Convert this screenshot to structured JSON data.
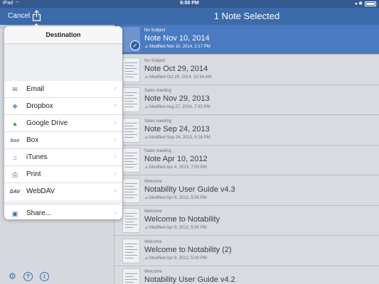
{
  "status_bar": {
    "device": "iPad",
    "wifi": "⌔",
    "time": "6:58 PM",
    "icons": "◂ ✱"
  },
  "nav": {
    "cancel_label": "Cancel",
    "title": "1 Note Selected"
  },
  "popover": {
    "title": "Destination",
    "items": [
      {
        "label": "Email",
        "icon": "email-icon",
        "glyph": "✉"
      },
      {
        "label": "Dropbox",
        "icon": "dropbox-icon",
        "glyph": "❖"
      },
      {
        "label": "Google Drive",
        "icon": "google-drive-icon",
        "glyph": "▲"
      },
      {
        "label": "Box",
        "icon": "box-icon",
        "glyph": "box"
      },
      {
        "label": "iTunes",
        "icon": "itunes-icon",
        "glyph": "♫"
      },
      {
        "label": "Print",
        "icon": "printer-icon",
        "glyph": "⎙"
      },
      {
        "label": "WebDAV",
        "icon": "webdav-icon",
        "glyph": "DAV"
      }
    ],
    "share": {
      "label": "Share...",
      "icon": "share-icon",
      "glyph": "▣"
    },
    "chevron": "›"
  },
  "sidebar_footer": {
    "settings_glyph": "⚙",
    "help_glyph": "?",
    "info_glyph": "i"
  },
  "notes": [
    {
      "subject": "No Subject",
      "title": "Note Nov 10, 2014",
      "modified": "Modified Nov 10, 2014, 2:17 PM",
      "selected": true
    },
    {
      "subject": "No Subject",
      "title": "Note Oct 29, 2014",
      "modified": "Modified Oct 29, 2014, 10:34 AM",
      "selected": false
    },
    {
      "subject": "Sales meeting",
      "title": "Note Nov 29, 2013",
      "modified": "Modified Aug 27, 2014, 7:33 PM",
      "selected": false
    },
    {
      "subject": "Sales meeting",
      "title": "Note Sep 24, 2013",
      "modified": "Modified Sep 24, 2013, 6:16 PM",
      "selected": false
    },
    {
      "subject": "Sales meeting",
      "title": "Note Apr 10, 2012",
      "modified": "Modified Apr 4, 2013, 7:03 PM",
      "selected": false
    },
    {
      "subject": "Welcome",
      "title": "Notability User Guide v4.3",
      "modified": "Modified Apr 9, 2012, 5:00 PM",
      "selected": false
    },
    {
      "subject": "Welcome",
      "title": "Welcome to Notability",
      "modified": "Modified Apr 9, 2012, 5:00 PM",
      "selected": false
    },
    {
      "subject": "Welcome",
      "title": "Welcome to Notability (2)",
      "modified": "Modified Apr 9, 2012, 5:00 PM",
      "selected": false
    },
    {
      "subject": "Welcome",
      "title": "Notability User Guide v4.2",
      "modified": "",
      "selected": false
    }
  ],
  "colors": {
    "accent": "#3b6baa",
    "selected_row": "#4a7ac0"
  },
  "check_glyph": "✓",
  "modified_glyph": "⊿"
}
